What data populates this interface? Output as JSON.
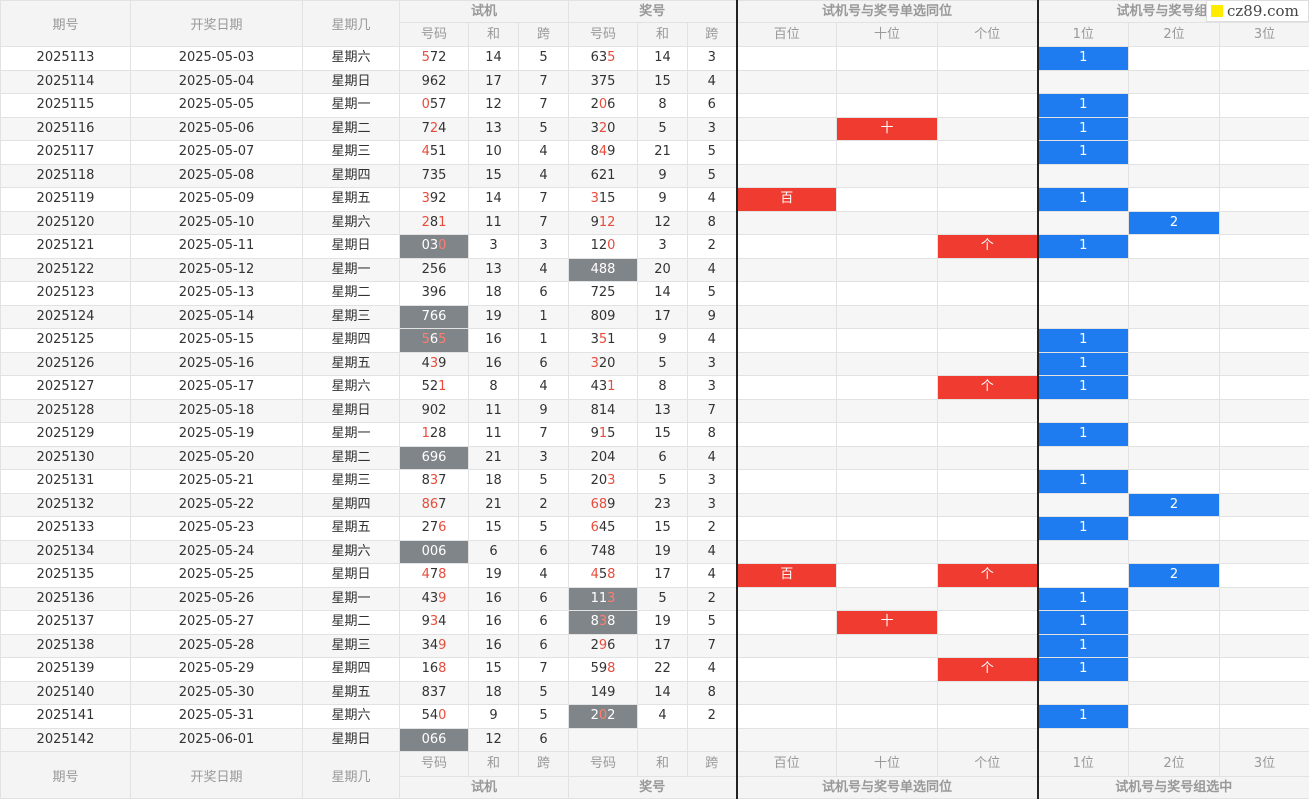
{
  "header": {
    "col_issue": "期号",
    "col_date": "开奖日期",
    "col_weekday": "星期几",
    "group_trial": "试机",
    "group_prize": "奖号",
    "group_single": "试机号与奖号单选同位",
    "group_combo": "试机号与奖号组",
    "sub_number": "号码",
    "sub_sum": "和",
    "sub_span": "跨",
    "sub_bai": "百位",
    "sub_shi": "十位",
    "sub_ge": "个位",
    "sub_1": "1位",
    "sub_2": "2位",
    "sub_3": "3位"
  },
  "footer": {
    "col_issue": "期号",
    "col_date": "开奖日期",
    "col_weekday": "星期几",
    "sub_number": "号码",
    "sub_sum": "和",
    "sub_span": "跨",
    "sub_bai": "百位",
    "sub_shi": "十位",
    "sub_ge": "个位",
    "sub_1": "1位",
    "sub_2": "2位",
    "sub_3": "3位",
    "group_trial": "试机",
    "group_prize": "奖号",
    "group_single": "试机号与奖号单选同位",
    "group_combo": "试机号与奖号组选中"
  },
  "watermark": "cz89.com",
  "colors": {
    "red": "#f03b30",
    "blue": "#1e7cf0",
    "gray": "#80858a",
    "digit_red": "#e74c3c"
  },
  "rows": [
    {
      "issue": "2025113",
      "date": "2025-05-03",
      "weekday": "星期六",
      "trial": "572",
      "trial_hl": [
        0
      ],
      "trial_gray": false,
      "tsum": "14",
      "tspan": "5",
      "prize": "635",
      "prize_hl": [
        2
      ],
      "prize_gray": false,
      "psum": "14",
      "pspan": "3",
      "bai": "",
      "shi": "",
      "ge": "",
      "c1": "1",
      "c2": "",
      "c3": ""
    },
    {
      "issue": "2025114",
      "date": "2025-05-04",
      "weekday": "星期日",
      "trial": "962",
      "trial_hl": [],
      "trial_gray": false,
      "tsum": "17",
      "tspan": "7",
      "prize": "375",
      "prize_hl": [],
      "prize_gray": false,
      "psum": "15",
      "pspan": "4",
      "bai": "",
      "shi": "",
      "ge": "",
      "c1": "",
      "c2": "",
      "c3": ""
    },
    {
      "issue": "2025115",
      "date": "2025-05-05",
      "weekday": "星期一",
      "trial": "057",
      "trial_hl": [
        0
      ],
      "trial_gray": false,
      "tsum": "12",
      "tspan": "7",
      "prize": "206",
      "prize_hl": [
        1
      ],
      "prize_gray": false,
      "psum": "8",
      "pspan": "6",
      "bai": "",
      "shi": "",
      "ge": "",
      "c1": "1",
      "c2": "",
      "c3": ""
    },
    {
      "issue": "2025116",
      "date": "2025-05-06",
      "weekday": "星期二",
      "trial": "724",
      "trial_hl": [
        1
      ],
      "trial_gray": false,
      "tsum": "13",
      "tspan": "5",
      "prize": "320",
      "prize_hl": [
        1
      ],
      "prize_gray": false,
      "psum": "5",
      "pspan": "3",
      "bai": "",
      "shi": "十",
      "ge": "",
      "c1": "1",
      "c2": "",
      "c3": ""
    },
    {
      "issue": "2025117",
      "date": "2025-05-07",
      "weekday": "星期三",
      "trial": "451",
      "trial_hl": [
        0
      ],
      "trial_gray": false,
      "tsum": "10",
      "tspan": "4",
      "prize": "849",
      "prize_hl": [
        1
      ],
      "prize_gray": false,
      "psum": "21",
      "pspan": "5",
      "bai": "",
      "shi": "",
      "ge": "",
      "c1": "1",
      "c2": "",
      "c3": ""
    },
    {
      "issue": "2025118",
      "date": "2025-05-08",
      "weekday": "星期四",
      "trial": "735",
      "trial_hl": [],
      "trial_gray": false,
      "tsum": "15",
      "tspan": "4",
      "prize": "621",
      "prize_hl": [],
      "prize_gray": false,
      "psum": "9",
      "pspan": "5",
      "bai": "",
      "shi": "",
      "ge": "",
      "c1": "",
      "c2": "",
      "c3": ""
    },
    {
      "issue": "2025119",
      "date": "2025-05-09",
      "weekday": "星期五",
      "trial": "392",
      "trial_hl": [
        0
      ],
      "trial_gray": false,
      "tsum": "14",
      "tspan": "7",
      "prize": "315",
      "prize_hl": [
        0
      ],
      "prize_gray": false,
      "psum": "9",
      "pspan": "4",
      "bai": "百",
      "shi": "",
      "ge": "",
      "c1": "1",
      "c2": "",
      "c3": ""
    },
    {
      "issue": "2025120",
      "date": "2025-05-10",
      "weekday": "星期六",
      "trial": "281",
      "trial_hl": [
        0,
        2
      ],
      "trial_gray": false,
      "tsum": "11",
      "tspan": "7",
      "prize": "912",
      "prize_hl": [
        1,
        2
      ],
      "prize_gray": false,
      "psum": "12",
      "pspan": "8",
      "bai": "",
      "shi": "",
      "ge": "",
      "c1": "",
      "c2": "2",
      "c3": ""
    },
    {
      "issue": "2025121",
      "date": "2025-05-11",
      "weekday": "星期日",
      "trial": "030",
      "trial_hl": [
        2
      ],
      "trial_gray": true,
      "tsum": "3",
      "tspan": "3",
      "prize": "120",
      "prize_hl": [
        2
      ],
      "prize_gray": false,
      "psum": "3",
      "pspan": "2",
      "bai": "",
      "shi": "",
      "ge": "个",
      "c1": "1",
      "c2": "",
      "c3": ""
    },
    {
      "issue": "2025122",
      "date": "2025-05-12",
      "weekday": "星期一",
      "trial": "256",
      "trial_hl": [],
      "trial_gray": false,
      "tsum": "13",
      "tspan": "4",
      "prize": "488",
      "prize_hl": [],
      "prize_gray": true,
      "psum": "20",
      "pspan": "4",
      "bai": "",
      "shi": "",
      "ge": "",
      "c1": "",
      "c2": "",
      "c3": ""
    },
    {
      "issue": "2025123",
      "date": "2025-05-13",
      "weekday": "星期二",
      "trial": "396",
      "trial_hl": [],
      "trial_gray": false,
      "tsum": "18",
      "tspan": "6",
      "prize": "725",
      "prize_hl": [],
      "prize_gray": false,
      "psum": "14",
      "pspan": "5",
      "bai": "",
      "shi": "",
      "ge": "",
      "c1": "",
      "c2": "",
      "c3": ""
    },
    {
      "issue": "2025124",
      "date": "2025-05-14",
      "weekday": "星期三",
      "trial": "766",
      "trial_hl": [],
      "trial_gray": true,
      "tsum": "19",
      "tspan": "1",
      "prize": "809",
      "prize_hl": [],
      "prize_gray": false,
      "psum": "17",
      "pspan": "9",
      "bai": "",
      "shi": "",
      "ge": "",
      "c1": "",
      "c2": "",
      "c3": ""
    },
    {
      "issue": "2025125",
      "date": "2025-05-15",
      "weekday": "星期四",
      "trial": "565",
      "trial_hl": [
        0,
        2
      ],
      "trial_gray": true,
      "tsum": "16",
      "tspan": "1",
      "prize": "351",
      "prize_hl": [
        1
      ],
      "prize_gray": false,
      "psum": "9",
      "pspan": "4",
      "bai": "",
      "shi": "",
      "ge": "",
      "c1": "1",
      "c2": "",
      "c3": ""
    },
    {
      "issue": "2025126",
      "date": "2025-05-16",
      "weekday": "星期五",
      "trial": "439",
      "trial_hl": [
        1
      ],
      "trial_gray": false,
      "tsum": "16",
      "tspan": "6",
      "prize": "320",
      "prize_hl": [
        0
      ],
      "prize_gray": false,
      "psum": "5",
      "pspan": "3",
      "bai": "",
      "shi": "",
      "ge": "",
      "c1": "1",
      "c2": "",
      "c3": ""
    },
    {
      "issue": "2025127",
      "date": "2025-05-17",
      "weekday": "星期六",
      "trial": "521",
      "trial_hl": [
        2
      ],
      "trial_gray": false,
      "tsum": "8",
      "tspan": "4",
      "prize": "431",
      "prize_hl": [
        2
      ],
      "prize_gray": false,
      "psum": "8",
      "pspan": "3",
      "bai": "",
      "shi": "",
      "ge": "个",
      "c1": "1",
      "c2": "",
      "c3": ""
    },
    {
      "issue": "2025128",
      "date": "2025-05-18",
      "weekday": "星期日",
      "trial": "902",
      "trial_hl": [],
      "trial_gray": false,
      "tsum": "11",
      "tspan": "9",
      "prize": "814",
      "prize_hl": [],
      "prize_gray": false,
      "psum": "13",
      "pspan": "7",
      "bai": "",
      "shi": "",
      "ge": "",
      "c1": "",
      "c2": "",
      "c3": ""
    },
    {
      "issue": "2025129",
      "date": "2025-05-19",
      "weekday": "星期一",
      "trial": "128",
      "trial_hl": [
        0
      ],
      "trial_gray": false,
      "tsum": "11",
      "tspan": "7",
      "prize": "915",
      "prize_hl": [
        1
      ],
      "prize_gray": false,
      "psum": "15",
      "pspan": "8",
      "bai": "",
      "shi": "",
      "ge": "",
      "c1": "1",
      "c2": "",
      "c3": ""
    },
    {
      "issue": "2025130",
      "date": "2025-05-20",
      "weekday": "星期二",
      "trial": "696",
      "trial_hl": [],
      "trial_gray": true,
      "tsum": "21",
      "tspan": "3",
      "prize": "204",
      "prize_hl": [],
      "prize_gray": false,
      "psum": "6",
      "pspan": "4",
      "bai": "",
      "shi": "",
      "ge": "",
      "c1": "",
      "c2": "",
      "c3": ""
    },
    {
      "issue": "2025131",
      "date": "2025-05-21",
      "weekday": "星期三",
      "trial": "837",
      "trial_hl": [
        1
      ],
      "trial_gray": false,
      "tsum": "18",
      "tspan": "5",
      "prize": "203",
      "prize_hl": [
        2
      ],
      "prize_gray": false,
      "psum": "5",
      "pspan": "3",
      "bai": "",
      "shi": "",
      "ge": "",
      "c1": "1",
      "c2": "",
      "c3": ""
    },
    {
      "issue": "2025132",
      "date": "2025-05-22",
      "weekday": "星期四",
      "trial": "867",
      "trial_hl": [
        0,
        1
      ],
      "trial_gray": false,
      "tsum": "21",
      "tspan": "2",
      "prize": "689",
      "prize_hl": [
        0,
        1
      ],
      "prize_gray": false,
      "psum": "23",
      "pspan": "3",
      "bai": "",
      "shi": "",
      "ge": "",
      "c1": "",
      "c2": "2",
      "c3": ""
    },
    {
      "issue": "2025133",
      "date": "2025-05-23",
      "weekday": "星期五",
      "trial": "276",
      "trial_hl": [
        2
      ],
      "trial_gray": false,
      "tsum": "15",
      "tspan": "5",
      "prize": "645",
      "prize_hl": [
        0
      ],
      "prize_gray": false,
      "psum": "15",
      "pspan": "2",
      "bai": "",
      "shi": "",
      "ge": "",
      "c1": "1",
      "c2": "",
      "c3": ""
    },
    {
      "issue": "2025134",
      "date": "2025-05-24",
      "weekday": "星期六",
      "trial": "006",
      "trial_hl": [],
      "trial_gray": true,
      "tsum": "6",
      "tspan": "6",
      "prize": "748",
      "prize_hl": [],
      "prize_gray": false,
      "psum": "19",
      "pspan": "4",
      "bai": "",
      "shi": "",
      "ge": "",
      "c1": "",
      "c2": "",
      "c3": ""
    },
    {
      "issue": "2025135",
      "date": "2025-05-25",
      "weekday": "星期日",
      "trial": "478",
      "trial_hl": [
        0,
        2
      ],
      "trial_gray": false,
      "tsum": "19",
      "tspan": "4",
      "prize": "458",
      "prize_hl": [
        0,
        2
      ],
      "prize_gray": false,
      "psum": "17",
      "pspan": "4",
      "bai": "百",
      "shi": "",
      "ge": "个",
      "c1": "",
      "c2": "2",
      "c3": ""
    },
    {
      "issue": "2025136",
      "date": "2025-05-26",
      "weekday": "星期一",
      "trial": "439",
      "trial_hl": [
        2
      ],
      "trial_gray": false,
      "tsum": "16",
      "tspan": "6",
      "prize": "113",
      "prize_hl": [
        2
      ],
      "prize_gray": true,
      "psum": "5",
      "pspan": "2",
      "bai": "",
      "shi": "",
      "ge": "",
      "c1": "1",
      "c2": "",
      "c3": ""
    },
    {
      "issue": "2025137",
      "date": "2025-05-27",
      "weekday": "星期二",
      "trial": "934",
      "trial_hl": [
        1
      ],
      "trial_gray": false,
      "tsum": "16",
      "tspan": "6",
      "prize": "838",
      "prize_hl": [
        1
      ],
      "prize_gray": true,
      "psum": "19",
      "pspan": "5",
      "bai": "",
      "shi": "十",
      "ge": "",
      "c1": "1",
      "c2": "",
      "c3": ""
    },
    {
      "issue": "2025138",
      "date": "2025-05-28",
      "weekday": "星期三",
      "trial": "349",
      "trial_hl": [
        2
      ],
      "trial_gray": false,
      "tsum": "16",
      "tspan": "6",
      "prize": "296",
      "prize_hl": [
        1
      ],
      "prize_gray": false,
      "psum": "17",
      "pspan": "7",
      "bai": "",
      "shi": "",
      "ge": "",
      "c1": "1",
      "c2": "",
      "c3": ""
    },
    {
      "issue": "2025139",
      "date": "2025-05-29",
      "weekday": "星期四",
      "trial": "168",
      "trial_hl": [
        2
      ],
      "trial_gray": false,
      "tsum": "15",
      "tspan": "7",
      "prize": "598",
      "prize_hl": [
        2
      ],
      "prize_gray": false,
      "psum": "22",
      "pspan": "4",
      "bai": "",
      "shi": "",
      "ge": "个",
      "c1": "1",
      "c2": "",
      "c3": ""
    },
    {
      "issue": "2025140",
      "date": "2025-05-30",
      "weekday": "星期五",
      "trial": "837",
      "trial_hl": [],
      "trial_gray": false,
      "tsum": "18",
      "tspan": "5",
      "prize": "149",
      "prize_hl": [],
      "prize_gray": false,
      "psum": "14",
      "pspan": "8",
      "bai": "",
      "shi": "",
      "ge": "",
      "c1": "",
      "c2": "",
      "c3": ""
    },
    {
      "issue": "2025141",
      "date": "2025-05-31",
      "weekday": "星期六",
      "trial": "540",
      "trial_hl": [
        2
      ],
      "trial_gray": false,
      "tsum": "9",
      "tspan": "5",
      "prize": "202",
      "prize_hl": [
        1
      ],
      "prize_gray": true,
      "psum": "4",
      "pspan": "2",
      "bai": "",
      "shi": "",
      "ge": "",
      "c1": "1",
      "c2": "",
      "c3": ""
    },
    {
      "issue": "2025142",
      "date": "2025-06-01",
      "weekday": "星期日",
      "trial": "066",
      "trial_hl": [],
      "trial_gray": true,
      "tsum": "12",
      "tspan": "6",
      "prize": "",
      "prize_hl": [],
      "prize_gray": false,
      "psum": "",
      "pspan": "",
      "bai": "",
      "shi": "",
      "ge": "",
      "c1": "",
      "c2": "",
      "c3": ""
    }
  ]
}
